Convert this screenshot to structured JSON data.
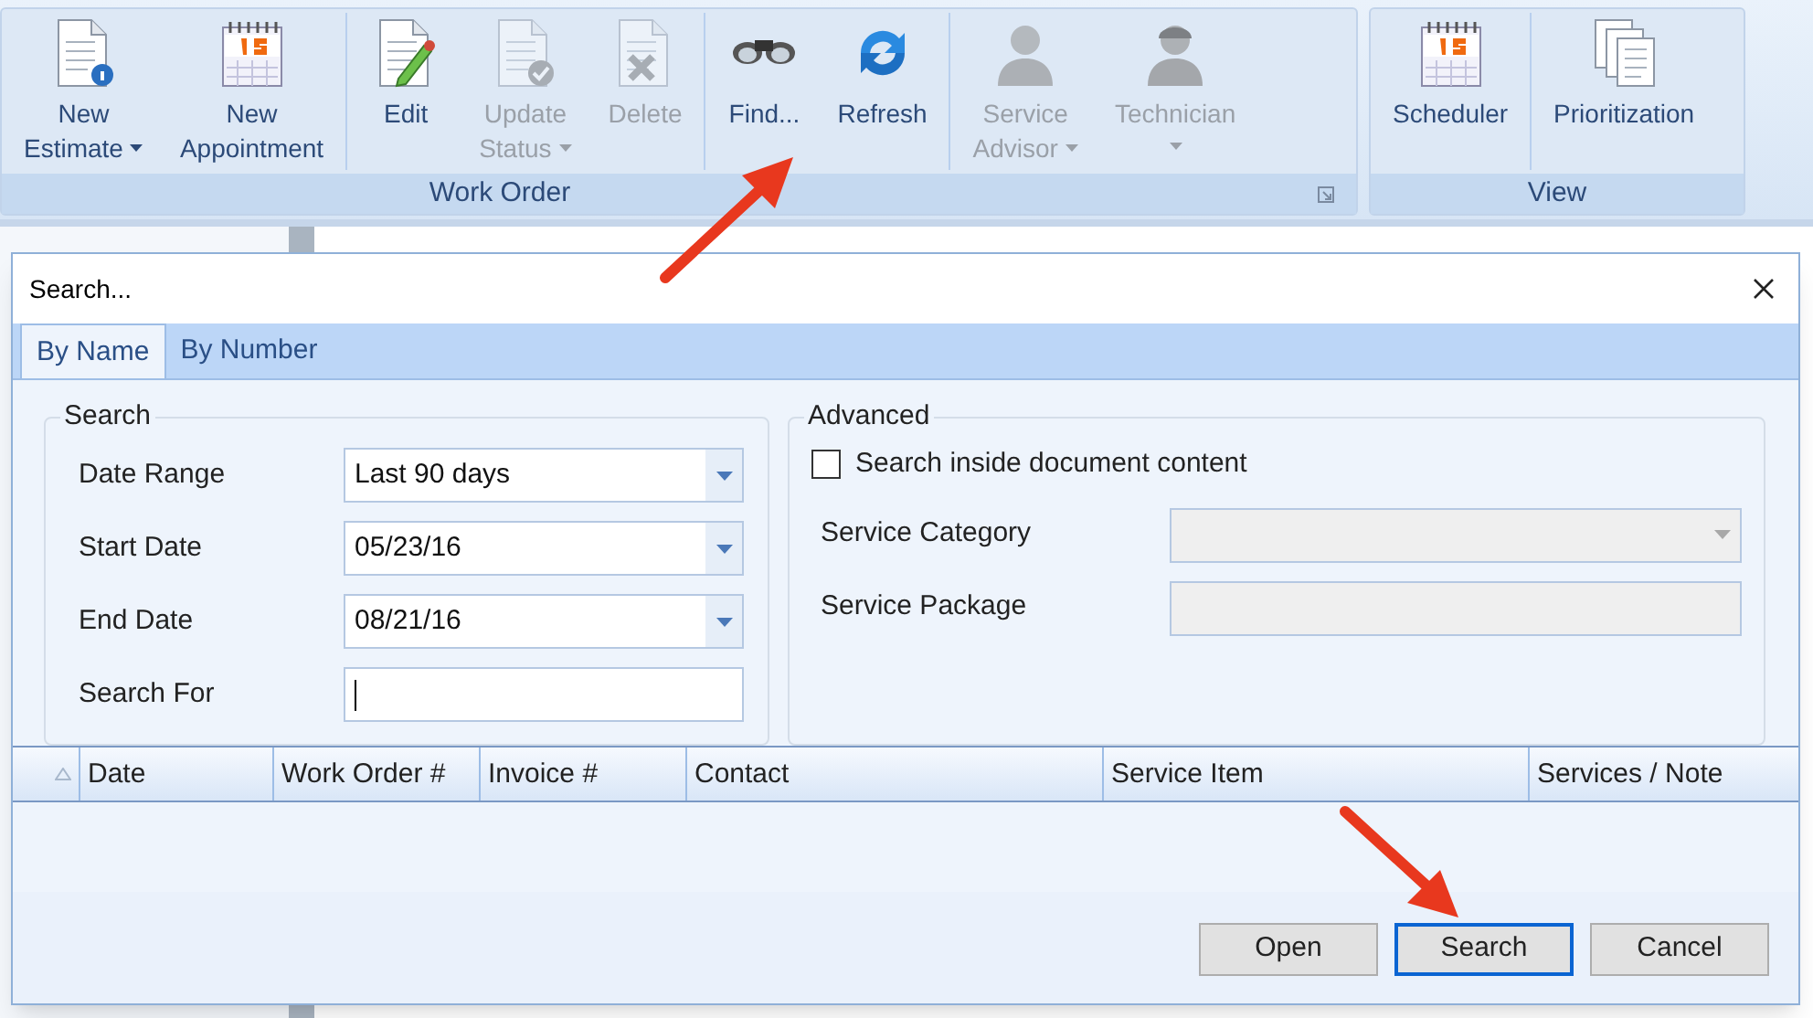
{
  "ribbon": {
    "groups": [
      {
        "label": "Work Order",
        "launcher": true,
        "sections": [
          [
            {
              "kind": "estimate",
              "lines": [
                "New",
                "Estimate"
              ],
              "dropdown": true,
              "disabled": false
            },
            {
              "kind": "calendar",
              "lines": [
                "New",
                "Appointment"
              ],
              "dropdown": false,
              "disabled": false
            }
          ],
          [
            {
              "kind": "edit",
              "lines": [
                "Edit"
              ],
              "dropdown": false,
              "disabled": false
            },
            {
              "kind": "status",
              "lines": [
                "Update",
                "Status"
              ],
              "dropdown": true,
              "disabled": true
            },
            {
              "kind": "delete",
              "lines": [
                "Delete"
              ],
              "dropdown": false,
              "disabled": true
            }
          ],
          [
            {
              "kind": "find",
              "lines": [
                "Find..."
              ],
              "dropdown": false,
              "disabled": false
            },
            {
              "kind": "refresh",
              "lines": [
                "Refresh"
              ],
              "dropdown": false,
              "disabled": false
            }
          ],
          [
            {
              "kind": "person",
              "lines": [
                "Service",
                "Advisor"
              ],
              "dropdown": true,
              "disabled": true
            },
            {
              "kind": "person-cap",
              "lines": [
                "Technician"
              ],
              "dropdown": true,
              "disabled": true
            }
          ]
        ]
      },
      {
        "label": "View",
        "launcher": false,
        "sections": [
          [
            {
              "kind": "calendar",
              "lines": [
                "Scheduler"
              ],
              "dropdown": false,
              "disabled": false
            }
          ],
          [
            {
              "kind": "documents",
              "lines": [
                "Prioritization"
              ],
              "dropdown": false,
              "disabled": false
            }
          ]
        ]
      }
    ]
  },
  "dialog": {
    "title": "Search...",
    "tabs": [
      {
        "label": "By Name",
        "selected": true
      },
      {
        "label": "By Number",
        "selected": false
      }
    ],
    "search": {
      "title": "Search",
      "rows": [
        {
          "kind": "dropdown",
          "label": "Date Range",
          "value": "Last 90 days"
        },
        {
          "kind": "dropdown",
          "label": "Start Date",
          "value": "05/23/16"
        },
        {
          "kind": "dropdown",
          "label": "End Date",
          "value": "08/21/16"
        },
        {
          "kind": "text",
          "label": "Search For",
          "value": "",
          "focused": true
        }
      ]
    },
    "advanced": {
      "title": "Advanced",
      "checkbox": {
        "label": "Search inside document content",
        "checked": false
      },
      "rows": [
        {
          "kind": "dropdown",
          "label": "Service Category",
          "disabled": true
        },
        {
          "kind": "text",
          "label": "Service Package",
          "disabled": true
        }
      ]
    },
    "table": {
      "columns": [
        "Date",
        "Work Order #",
        "Invoice #",
        "Contact",
        "Service Item",
        "Services / Note"
      ]
    },
    "buttons": [
      {
        "label": "Open",
        "default": false
      },
      {
        "label": "Search",
        "default": true
      },
      {
        "label": "Cancel",
        "default": false
      }
    ]
  }
}
